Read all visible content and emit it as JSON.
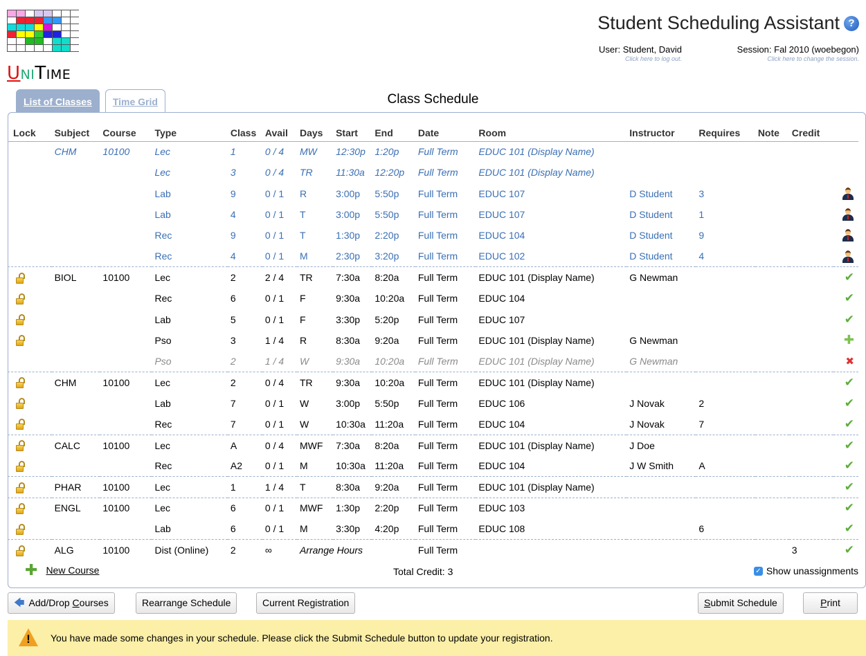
{
  "logo": {
    "text_u": "U",
    "text_ni": "NI",
    "text_t": "T",
    "text_ime": "IME"
  },
  "header": {
    "title": "Student Scheduling Assistant",
    "user_label": "User: Student, David",
    "user_sub": "Click here to log out.",
    "session_label": "Session: Fal 2010 (woebegon)",
    "session_sub": "Click here to change the session."
  },
  "tabs": [
    {
      "label": "List of Classes",
      "active": true
    },
    {
      "label": "Time Grid",
      "active": false
    }
  ],
  "section_title": "Class Schedule",
  "columns": [
    "Lock",
    "Subject",
    "Course",
    "Type",
    "Class",
    "Avail",
    "Days",
    "Start",
    "End",
    "Date",
    "Room",
    "Instructor",
    "Requires",
    "Note",
    "Credit"
  ],
  "rows": [
    {
      "style": "blue italic",
      "lock": false,
      "subject": "CHM",
      "course": "10100",
      "type": "Lec",
      "cls": "1",
      "avail": "0 / 4",
      "days": "MW",
      "start": "12:30p",
      "end": "1:20p",
      "date": "Full Term",
      "room": "EDUC 101 (Display Name)",
      "instructor": "",
      "requires": "",
      "note": "",
      "credit": "",
      "status": "",
      "end_group": false
    },
    {
      "style": "blue italic",
      "lock": false,
      "subject": "",
      "course": "",
      "type": "Lec",
      "cls": "3",
      "avail": "0 / 4",
      "days": "TR",
      "start": "11:30a",
      "end": "12:20p",
      "date": "Full Term",
      "room": "EDUC 101 (Display Name)",
      "instructor": "",
      "requires": "",
      "note": "",
      "credit": "",
      "status": "",
      "end_group": false
    },
    {
      "style": "blue",
      "lock": false,
      "subject": "",
      "course": "",
      "type": "Lab",
      "cls": "9",
      "avail": "0 / 1",
      "days": "R",
      "start": "3:00p",
      "end": "5:50p",
      "date": "Full Term",
      "room": "EDUC 107",
      "instructor": "D Student",
      "requires": "3",
      "note": "",
      "credit": "",
      "status": "person",
      "end_group": false
    },
    {
      "style": "blue",
      "lock": false,
      "subject": "",
      "course": "",
      "type": "Lab",
      "cls": "4",
      "avail": "0 / 1",
      "days": "T",
      "start": "3:00p",
      "end": "5:50p",
      "date": "Full Term",
      "room": "EDUC 107",
      "instructor": "D Student",
      "requires": "1",
      "note": "",
      "credit": "",
      "status": "person",
      "end_group": false
    },
    {
      "style": "blue",
      "lock": false,
      "subject": "",
      "course": "",
      "type": "Rec",
      "cls": "9",
      "avail": "0 / 1",
      "days": "T",
      "start": "1:30p",
      "end": "2:20p",
      "date": "Full Term",
      "room": "EDUC 104",
      "instructor": "D Student",
      "requires": "9",
      "note": "",
      "credit": "",
      "status": "person",
      "end_group": false
    },
    {
      "style": "blue",
      "lock": false,
      "subject": "",
      "course": "",
      "type": "Rec",
      "cls": "4",
      "avail": "0 / 1",
      "days": "M",
      "start": "2:30p",
      "end": "3:20p",
      "date": "Full Term",
      "room": "EDUC 102",
      "instructor": "D Student",
      "requires": "4",
      "note": "",
      "credit": "",
      "status": "person",
      "end_group": true
    },
    {
      "style": "",
      "lock": true,
      "subject": "BIOL",
      "course": "10100",
      "type": "Lec",
      "cls": "2",
      "avail": "2 / 4",
      "days": "TR",
      "start": "7:30a",
      "end": "8:20a",
      "date": "Full Term",
      "room": "EDUC 101 (Display Name)",
      "instructor": "G Newman",
      "requires": "",
      "note": "",
      "credit": "",
      "status": "check",
      "end_group": false
    },
    {
      "style": "",
      "lock": true,
      "subject": "",
      "course": "",
      "type": "Rec",
      "cls": "6",
      "avail": "0 / 1",
      "days": "F",
      "start": "9:30a",
      "end": "10:20a",
      "date": "Full Term",
      "room": "EDUC 104",
      "instructor": "",
      "requires": "",
      "note": "",
      "credit": "",
      "status": "check",
      "end_group": false
    },
    {
      "style": "",
      "lock": true,
      "subject": "",
      "course": "",
      "type": "Lab",
      "cls": "5",
      "avail": "0 / 1",
      "days": "F",
      "start": "3:30p",
      "end": "5:20p",
      "date": "Full Term",
      "room": "EDUC 107",
      "instructor": "",
      "requires": "",
      "note": "",
      "credit": "",
      "status": "check",
      "end_group": false
    },
    {
      "style": "",
      "lock": true,
      "subject": "",
      "course": "",
      "type": "Pso",
      "cls": "3",
      "avail": "1 / 4",
      "days": "R",
      "start": "8:30a",
      "end": "9:20a",
      "date": "Full Term",
      "room": "EDUC 101 (Display Name)",
      "instructor": "G Newman",
      "requires": "",
      "note": "",
      "credit": "",
      "status": "plus",
      "end_group": false
    },
    {
      "style": "gray",
      "lock": false,
      "subject": "",
      "course": "",
      "type": "Pso",
      "cls": "2",
      "avail": "1 / 4",
      "days": "W",
      "start": "9:30a",
      "end": "10:20a",
      "date": "Full Term",
      "room": "EDUC 101 (Display Name)",
      "instructor": "G Newman",
      "requires": "",
      "note": "",
      "credit": "",
      "status": "cross",
      "end_group": true
    },
    {
      "style": "",
      "lock": true,
      "subject": "CHM",
      "course": "10100",
      "type": "Lec",
      "cls": "2",
      "avail": "0 / 4",
      "days": "TR",
      "start": "9:30a",
      "end": "10:20a",
      "date": "Full Term",
      "room": "EDUC 101 (Display Name)",
      "instructor": "",
      "requires": "",
      "note": "",
      "credit": "",
      "status": "check",
      "end_group": false
    },
    {
      "style": "",
      "lock": true,
      "subject": "",
      "course": "",
      "type": "Lab",
      "cls": "7",
      "avail": "0 / 1",
      "days": "W",
      "start": "3:00p",
      "end": "5:50p",
      "date": "Full Term",
      "room": "EDUC 106",
      "instructor": "J Novak",
      "requires": "2",
      "note": "",
      "credit": "",
      "status": "check",
      "end_group": false
    },
    {
      "style": "",
      "lock": true,
      "subject": "",
      "course": "",
      "type": "Rec",
      "cls": "7",
      "avail": "0 / 1",
      "days": "W",
      "start": "10:30a",
      "end": "11:20a",
      "date": "Full Term",
      "room": "EDUC 104",
      "instructor": "J Novak",
      "requires": "7",
      "note": "",
      "credit": "",
      "status": "check",
      "end_group": true
    },
    {
      "style": "",
      "lock": true,
      "subject": "CALC",
      "course": "10100",
      "type": "Lec",
      "cls": "A",
      "avail": "0 / 4",
      "days": "MWF",
      "start": "7:30a",
      "end": "8:20a",
      "date": "Full Term",
      "room": "EDUC 101 (Display Name)",
      "instructor": "J Doe",
      "requires": "",
      "note": "",
      "credit": "",
      "status": "check",
      "end_group": false
    },
    {
      "style": "",
      "lock": true,
      "subject": "",
      "course": "",
      "type": "Rec",
      "cls": "A2",
      "avail": "0 / 1",
      "days": "M",
      "start": "10:30a",
      "end": "11:20a",
      "date": "Full Term",
      "room": "EDUC 104",
      "instructor": "J W Smith",
      "requires": "A",
      "note": "",
      "credit": "",
      "status": "check",
      "end_group": true
    },
    {
      "style": "",
      "lock": true,
      "subject": "PHAR",
      "course": "10100",
      "type": "Lec",
      "cls": "1",
      "avail": "1 / 4",
      "days": "T",
      "start": "8:30a",
      "end": "9:20a",
      "date": "Full Term",
      "room": "EDUC 101 (Display Name)",
      "instructor": "",
      "requires": "",
      "note": "",
      "credit": "",
      "status": "check",
      "end_group": true
    },
    {
      "style": "",
      "lock": true,
      "subject": "ENGL",
      "course": "10100",
      "type": "Lec",
      "cls": "6",
      "avail": "0 / 1",
      "days": "MWF",
      "start": "1:30p",
      "end": "2:20p",
      "date": "Full Term",
      "room": "EDUC 103",
      "instructor": "",
      "requires": "",
      "note": "",
      "credit": "",
      "status": "check",
      "end_group": false
    },
    {
      "style": "",
      "lock": true,
      "subject": "",
      "course": "",
      "type": "Lab",
      "cls": "6",
      "avail": "0 / 1",
      "days": "M",
      "start": "3:30p",
      "end": "4:20p",
      "date": "Full Term",
      "room": "EDUC 108",
      "instructor": "",
      "requires": "6",
      "note": "",
      "credit": "",
      "status": "check",
      "end_group": true
    },
    {
      "style": "",
      "lock": true,
      "subject": "ALG",
      "course": "10100",
      "type": "Dist (Online)",
      "cls": "2",
      "avail": "∞",
      "days": "Arrange Hours",
      "start": "",
      "end": "",
      "date": "Full Term",
      "room": "",
      "instructor": "",
      "requires": "",
      "note": "",
      "credit": "3",
      "status": "check",
      "end_group": false,
      "arrange": true
    }
  ],
  "footer": {
    "new_course": "New Course",
    "total_credit": "Total Credit: 3",
    "show_unassignments": "Show unassignments",
    "show_unassignments_checked": true
  },
  "buttons": {
    "add_drop_pre": "Add/Drop ",
    "add_drop_u": "C",
    "add_drop_post": "ourses",
    "rearrange": "Rearrange Schedule",
    "current_registration": "Current Registration",
    "submit_u": "S",
    "submit_post": "ubmit Schedule",
    "print_u": "P",
    "print_post": "rint"
  },
  "warning": "You have made some changes in your schedule. Please click the Submit Schedule button to update your registration.",
  "colors": {
    "accent": "#9cb0ce",
    "link_blue": "#3a6fb4",
    "warning_bg": "#fcefa8",
    "check_green": "#5cae3a"
  }
}
